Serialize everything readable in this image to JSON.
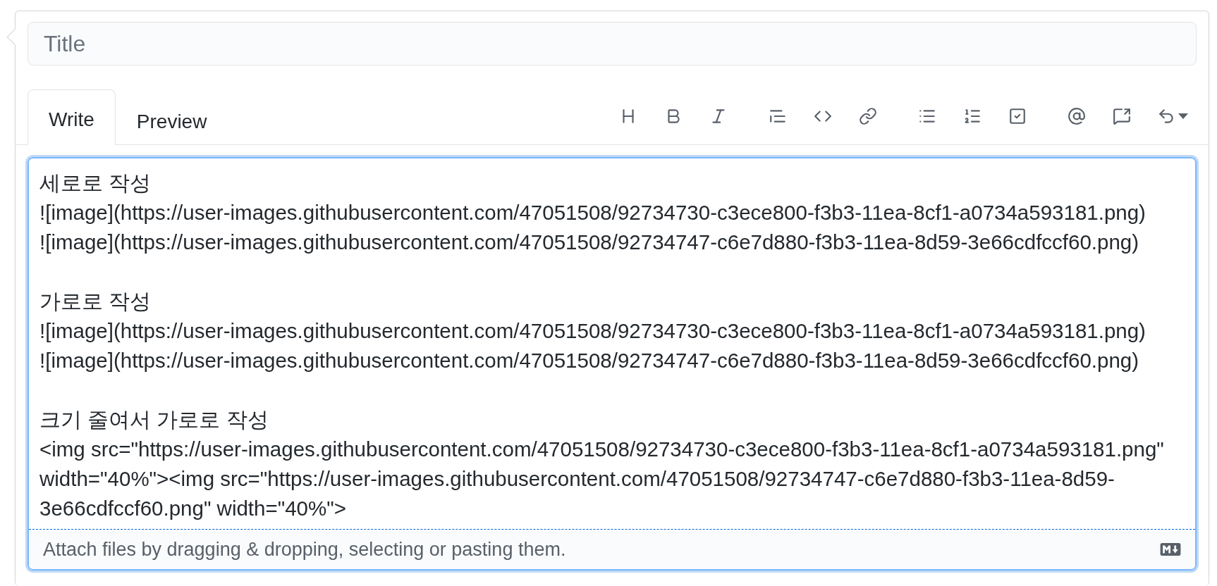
{
  "title_field": {
    "placeholder": "Title"
  },
  "tabs": [
    {
      "label": "Write",
      "selected": true
    },
    {
      "label": "Preview",
      "selected": false
    }
  ],
  "body": {
    "blocks": [
      {
        "lines": [
          "세로로 작성",
          "![image](https://user-images.githubusercontent.com/47051508/92734730-c3ece800-f3b3-11ea-8cf1-a0734a593181.png)",
          "![image](https://user-images.githubusercontent.com/47051508/92734747-c6e7d880-f3b3-11ea-8d59-3e66cdfccf60.png)"
        ]
      },
      {
        "lines": [
          "가로로 작성",
          "![image](https://user-images.githubusercontent.com/47051508/92734730-c3ece800-f3b3-11ea-8cf1-a0734a593181.png)",
          "![image](https://user-images.githubusercontent.com/47051508/92734747-c6e7d880-f3b3-11ea-8d59-3e66cdfccf60.png)"
        ]
      },
      {
        "lines": [
          "크기 줄여서 가로로 작성",
          "<img src=\"https://user-images.githubusercontent.com/47051508/92734730-c3ece800-f3b3-11ea-8cf1-a0734a593181.png\" width=\"40%\"><img src=\"https://user-images.githubusercontent.com/47051508/92734747-c6e7d880-f3b3-11ea-8d59-3e66cdfccf60.png\" width=\"40%\">"
        ]
      }
    ]
  },
  "footer": {
    "hint": "Attach files by dragging & dropping, selecting or pasting them."
  }
}
